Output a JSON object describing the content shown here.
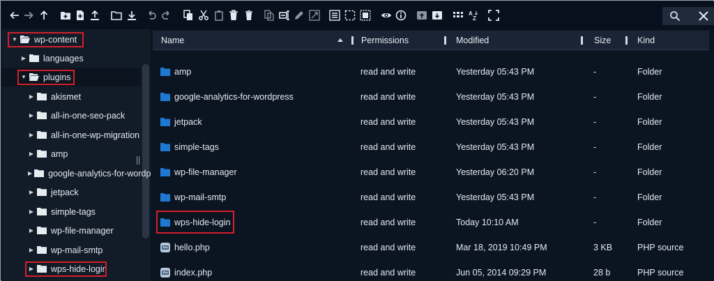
{
  "toolbar": {
    "buttons": [
      {
        "name": "back-icon",
        "glyph": "left-arrow"
      },
      {
        "name": "forward-icon",
        "glyph": "right-arrow"
      },
      {
        "name": "parent-folder-icon",
        "glyph": "up-arrow"
      },
      {
        "name": "new-folder-icon",
        "glyph": "folder-plus"
      },
      {
        "name": "new-file-icon",
        "glyph": "file-plus"
      },
      {
        "name": "upload-icon",
        "glyph": "upload"
      },
      {
        "name": "open-icon",
        "glyph": "folder"
      },
      {
        "name": "download-icon",
        "glyph": "download"
      },
      {
        "name": "undo-icon",
        "glyph": "undo"
      },
      {
        "name": "redo-icon",
        "glyph": "redo"
      },
      {
        "name": "copy-icon",
        "glyph": "copy"
      },
      {
        "name": "cut-icon",
        "glyph": "scissors"
      },
      {
        "name": "paste-icon",
        "glyph": "clipboard"
      },
      {
        "name": "delete-icon",
        "glyph": "trash"
      },
      {
        "name": "empty-icon",
        "glyph": "bin"
      },
      {
        "name": "duplicate-icon",
        "glyph": "duplicate"
      },
      {
        "name": "rename-icon",
        "glyph": "rename"
      },
      {
        "name": "edit-icon",
        "glyph": "pencil"
      },
      {
        "name": "resize-icon",
        "glyph": "resize"
      },
      {
        "name": "select-all-icon",
        "glyph": "select-all"
      },
      {
        "name": "select-none-icon",
        "glyph": "select-none"
      },
      {
        "name": "invert-selection-icon",
        "glyph": "invert"
      },
      {
        "name": "preview-icon",
        "glyph": "eye"
      },
      {
        "name": "info-icon",
        "glyph": "info"
      },
      {
        "name": "extract-icon",
        "glyph": "archive-up"
      },
      {
        "name": "archive-icon",
        "glyph": "archive-down"
      },
      {
        "name": "view-icon",
        "glyph": "grid"
      },
      {
        "name": "sort-icon",
        "glyph": "az"
      },
      {
        "name": "fullscreen-icon",
        "glyph": "fullscreen"
      }
    ],
    "search": {
      "placeholder": "",
      "value": ""
    }
  },
  "sidebar": {
    "items": [
      {
        "label": "wp-content",
        "level": 0,
        "expanded": true,
        "highlight": true
      },
      {
        "label": "languages",
        "level": 1,
        "expanded": false,
        "highlight": false
      },
      {
        "label": "plugins",
        "level": 1,
        "expanded": true,
        "highlight": true,
        "selected": true
      },
      {
        "label": "akismet",
        "level": 2,
        "expanded": false,
        "highlight": false
      },
      {
        "label": "all-in-one-seo-pack",
        "level": 2,
        "expanded": false,
        "highlight": false
      },
      {
        "label": "all-in-one-wp-migration",
        "level": 2,
        "expanded": false,
        "highlight": false
      },
      {
        "label": "amp",
        "level": 2,
        "expanded": false,
        "highlight": false
      },
      {
        "label": "google-analytics-for-wordpress",
        "level": 2,
        "expanded": false,
        "highlight": false
      },
      {
        "label": "jetpack",
        "level": 2,
        "expanded": false,
        "highlight": false
      },
      {
        "label": "simple-tags",
        "level": 2,
        "expanded": false,
        "highlight": false
      },
      {
        "label": "wp-file-manager",
        "level": 2,
        "expanded": false,
        "highlight": false
      },
      {
        "label": "wp-mail-smtp",
        "level": 2,
        "expanded": false,
        "highlight": false
      },
      {
        "label": "wps-hide-login",
        "level": 2,
        "expanded": false,
        "highlight": true
      }
    ]
  },
  "table": {
    "columns": [
      "Name",
      "Permissions",
      "Modified",
      "Size",
      "Kind"
    ],
    "sort_column": "Name",
    "rows": [
      {
        "name": "amp",
        "permissions": "read and write",
        "modified": "Yesterday 05:43 PM",
        "size": "-",
        "kind": "Folder",
        "type": "folder",
        "highlight": false
      },
      {
        "name": "google-analytics-for-wordpress",
        "permissions": "read and write",
        "modified": "Yesterday 05:43 PM",
        "size": "-",
        "kind": "Folder",
        "type": "folder",
        "highlight": false
      },
      {
        "name": "jetpack",
        "permissions": "read and write",
        "modified": "Yesterday 05:43 PM",
        "size": "-",
        "kind": "Folder",
        "type": "folder",
        "highlight": false
      },
      {
        "name": "simple-tags",
        "permissions": "read and write",
        "modified": "Yesterday 05:43 PM",
        "size": "-",
        "kind": "Folder",
        "type": "folder",
        "highlight": false
      },
      {
        "name": "wp-file-manager",
        "permissions": "read and write",
        "modified": "Yesterday 06:20 PM",
        "size": "-",
        "kind": "Folder",
        "type": "folder",
        "highlight": false
      },
      {
        "name": "wp-mail-smtp",
        "permissions": "read and write",
        "modified": "Yesterday 05:43 PM",
        "size": "-",
        "kind": "Folder",
        "type": "folder",
        "highlight": false
      },
      {
        "name": "wps-hide-login",
        "permissions": "read and write",
        "modified": "Today 10:10 AM",
        "size": "-",
        "kind": "Folder",
        "type": "folder",
        "highlight": true
      },
      {
        "name": "hello.php",
        "permissions": "read and write",
        "modified": "Mar 18, 2019 10:49 PM",
        "size": "3 KB",
        "kind": "PHP source",
        "type": "php",
        "highlight": false
      },
      {
        "name": "index.php",
        "permissions": "read and write",
        "modified": "Jun 05, 2014 09:29 PM",
        "size": "28 b",
        "kind": "PHP source",
        "type": "php",
        "highlight": false
      }
    ]
  },
  "colors": {
    "folder_blue": "#1f78d1",
    "highlight_red": "#d41f2a",
    "background": "#0b1522",
    "sidebar_bg": "#121c28",
    "header_bg": "#1a2434"
  }
}
